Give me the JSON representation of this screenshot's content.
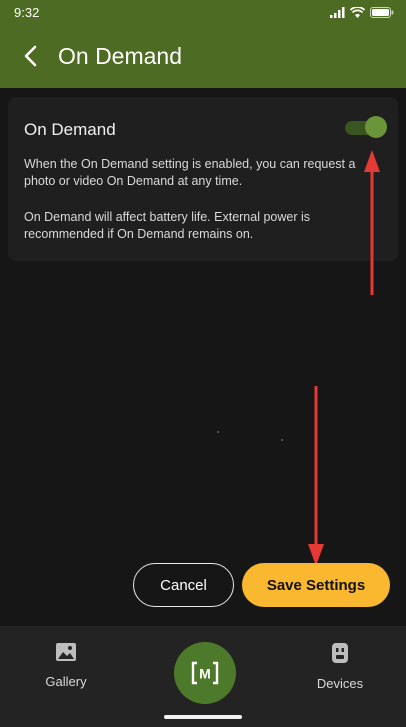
{
  "status_bar": {
    "time": "9:32"
  },
  "app_bar": {
    "title": "On Demand"
  },
  "card": {
    "title": "On Demand",
    "toggle_on": true,
    "paragraph1": "When the On Demand setting is enabled, you can request a photo or video On Demand at any time.",
    "paragraph2": "On Demand will affect battery life. External power is recommended if On Demand remains on."
  },
  "actions": {
    "cancel_label": "Cancel",
    "save_label": "Save Settings"
  },
  "bottom_nav": {
    "gallery_label": "Gallery",
    "center_label": "M",
    "devices_label": "Devices"
  },
  "colors": {
    "brand_green": "#4d6b22",
    "accent_yellow": "#f9b82f",
    "annotation_red": "#e53935"
  }
}
